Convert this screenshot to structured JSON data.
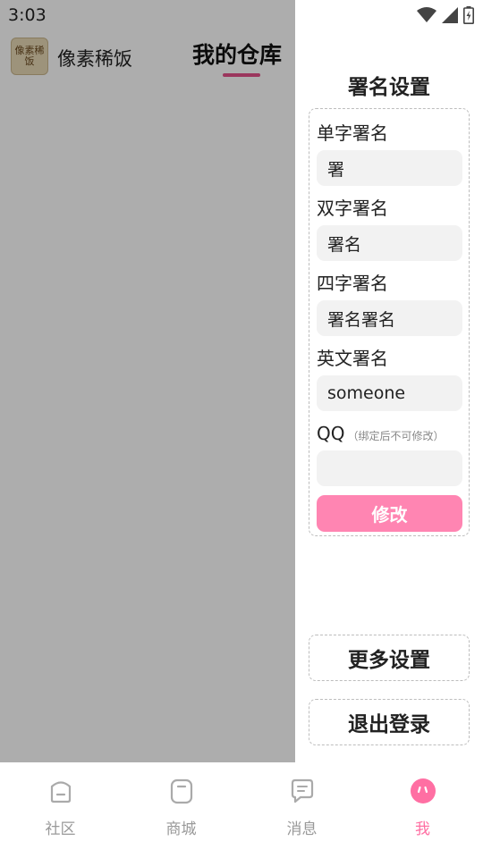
{
  "status_bar": {
    "time": "3:03"
  },
  "background": {
    "username": "像素稀饭",
    "avatar_text": "像素稀饭",
    "page_title": "我的仓库"
  },
  "drawer": {
    "title": "署名设置",
    "fields": [
      {
        "label": "单字署名",
        "value": "署"
      },
      {
        "label": "双字署名",
        "value": "署名"
      },
      {
        "label": "四字署名",
        "value": "署名署名"
      },
      {
        "label": "英文署名",
        "value": "someone"
      },
      {
        "label": "QQ",
        "hint": "（绑定后不可修改）",
        "value": ""
      }
    ],
    "modify_label": "修改",
    "more_settings_label": "更多设置",
    "logout_label": "退出登录"
  },
  "nav": [
    {
      "label": "社区",
      "icon": "community-icon",
      "active": false
    },
    {
      "label": "商城",
      "icon": "shop-icon",
      "active": false
    },
    {
      "label": "消息",
      "icon": "message-icon",
      "active": false
    },
    {
      "label": "我",
      "icon": "profile-icon",
      "active": true
    }
  ],
  "colors": {
    "accent": "#ff85b2",
    "nav_active": "#ff6fa3",
    "underline": "#e5508a"
  }
}
